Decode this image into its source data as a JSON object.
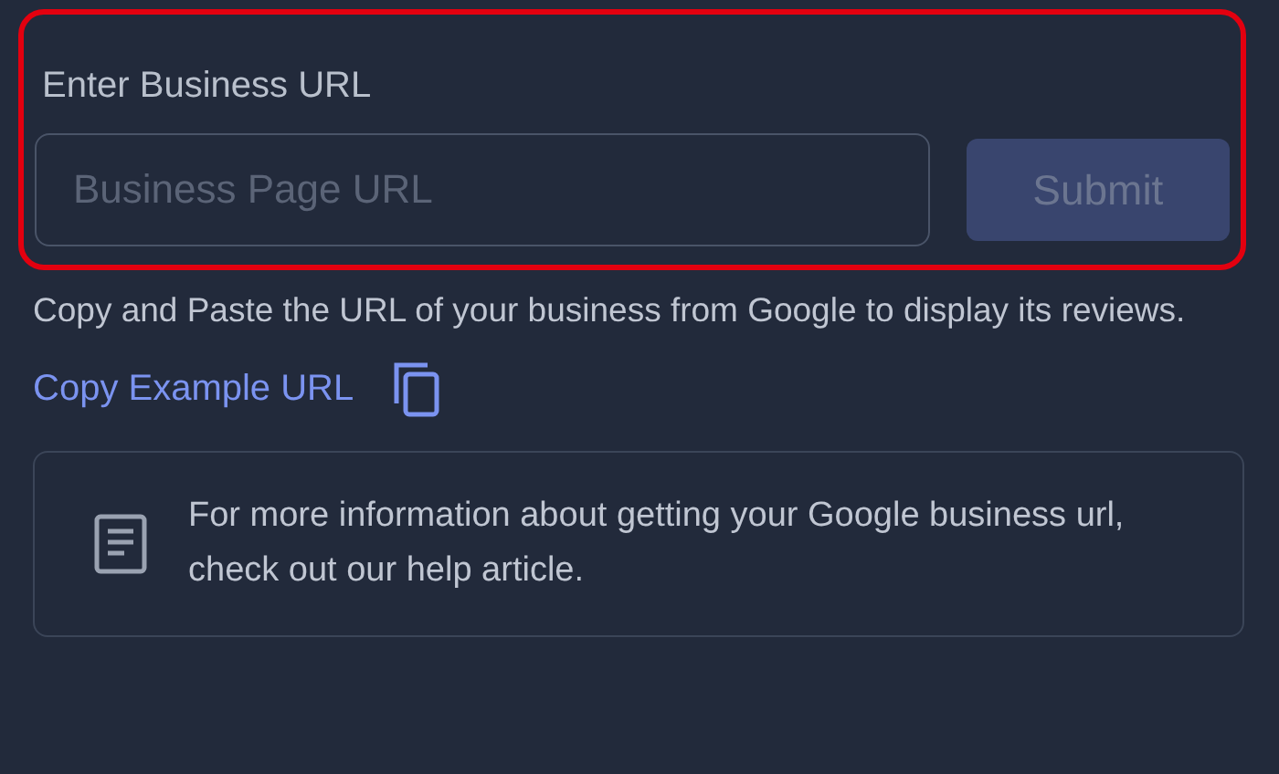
{
  "form": {
    "label": "Enter Business URL",
    "input": {
      "placeholder": "Business Page URL"
    },
    "submit": {
      "label": "Submit",
      "disabled": true
    }
  },
  "help_text": "Copy and Paste the URL of your business from Google to display its reviews.",
  "copy_link": {
    "label": "Copy Example URL"
  },
  "info_card": {
    "text": "For more information about getting your Google business url, check out our help article."
  }
}
